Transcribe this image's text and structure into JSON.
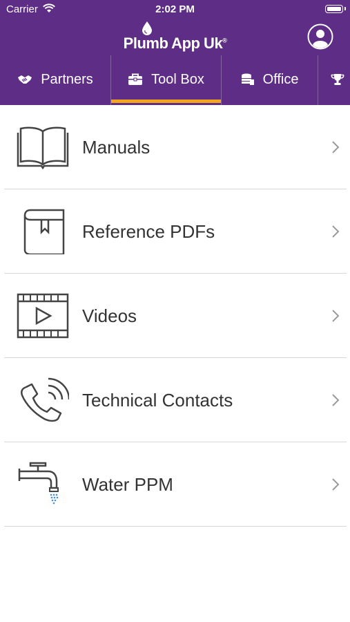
{
  "status_bar": {
    "carrier": "Carrier",
    "time": "2:02 PM"
  },
  "header": {
    "logo_text": "Plumb App Uk",
    "logo_mark": "®"
  },
  "tabs": [
    {
      "label": "Partners",
      "icon": "handshake-icon",
      "selected": false
    },
    {
      "label": "Tool Box",
      "icon": "briefcase-icon",
      "selected": true
    },
    {
      "label": "Office",
      "icon": "coins-stack-icon",
      "selected": false
    },
    {
      "label": "",
      "icon": "trophy-icon",
      "selected": false
    }
  ],
  "menu_items": [
    {
      "label": "Manuals",
      "icon": "open-book-icon"
    },
    {
      "label": "Reference PDFs",
      "icon": "bookmarked-book-icon"
    },
    {
      "label": "Videos",
      "icon": "video-play-icon"
    },
    {
      "label": "Technical Contacts",
      "icon": "phone-ringing-icon"
    },
    {
      "label": "Water PPM",
      "icon": "water-tap-icon"
    }
  ],
  "colors": {
    "header_bg": "#5e2d86",
    "tab_indicator": "#f3a51b",
    "text": "#333333",
    "divider": "#d6d6d6",
    "water_drops": "#4a8fd6"
  }
}
